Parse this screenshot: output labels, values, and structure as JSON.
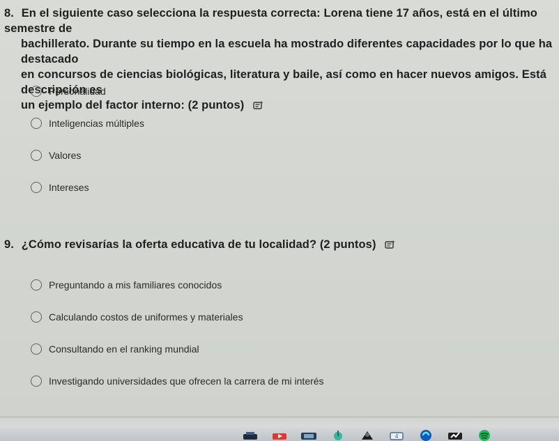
{
  "question8": {
    "number": "8.",
    "line1": "En el siguiente caso selecciona la respuesta correcta: Lorena tiene 17 años, está en el último semestre de",
    "line2": "bachillerato. Durante su tiempo en la escuela ha mostrado diferentes capacidades por lo que ha destacado",
    "line3": "en concursos de ciencias biológicas, literatura y baile, así como en hacer nuevos amigos. Está descripción es",
    "line4": "un ejemplo del factor interno:",
    "points": "(2 puntos)",
    "options": [
      {
        "label": "Personalidad"
      },
      {
        "label": "Inteligencias múltiples"
      },
      {
        "label": "Valores"
      },
      {
        "label": "Intereses"
      }
    ]
  },
  "question9": {
    "number": "9.",
    "text": "¿Cómo revisarías la oferta educativa de tu localidad?",
    "points": "(2 puntos)",
    "options": [
      {
        "label": "Preguntando a mis familiares conocidos"
      },
      {
        "label": "Calculando costos de uniformes y materiales"
      },
      {
        "label": "Consultando en el ranking mundial"
      },
      {
        "label": "Investigando universidades que ofrecen la carrera de mi interés"
      }
    ]
  },
  "taskbar": {
    "icons": [
      "app-icon",
      "video-icon",
      "app-icon",
      "music-icon",
      "app-icon",
      "app-icon",
      "edge-icon",
      "app-icon",
      "spotify-icon"
    ]
  },
  "colors": {
    "background": "#d6d9d4",
    "text": "#1f1f1f",
    "radio_border": "#5f5f5f"
  }
}
